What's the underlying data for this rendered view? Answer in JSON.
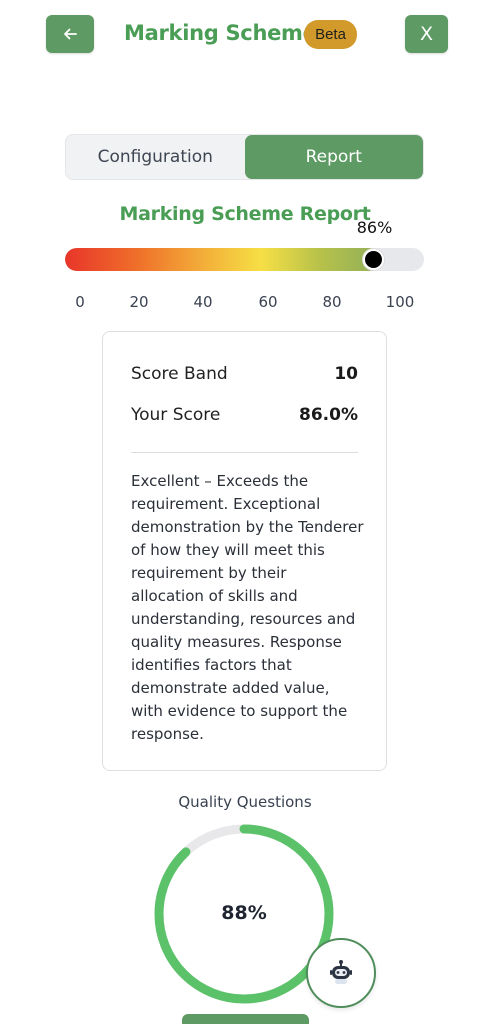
{
  "header": {
    "back_icon": "arrow-left-icon",
    "title": "Marking Scheme",
    "badge": "Beta",
    "close_label": "X"
  },
  "tabs": [
    {
      "label": "Configuration",
      "active": false
    },
    {
      "label": "Report",
      "active": true
    }
  ],
  "report": {
    "title": "Marking Scheme Report",
    "score_percent_label": "86%",
    "score_fraction": 0.86,
    "scale_ticks": [
      "0",
      "20",
      "40",
      "60",
      "80",
      "100"
    ]
  },
  "card": {
    "score_band_label": "Score Band",
    "score_band_value": "10",
    "your_score_label": "Your Score",
    "your_score_value": "86.0%",
    "description": "Excellent – Exceeds the requirement. Exceptional demonstration by the Tenderer of how they will meet this requirement by their allocation of skills and understanding, resources and quality measures. Response identifies factors that demonstrate added value, with evidence to support the response."
  },
  "quality": {
    "label": "Quality Questions",
    "value_label": "88%",
    "fraction": 0.88
  },
  "colors": {
    "primary": "#5e9a63",
    "title_green": "#4a9d55",
    "badge": "#d19a2a",
    "donut_green": "#5cc26a",
    "donut_track": "#e8e8ea"
  },
  "icons": {
    "assistant": "robot-icon"
  }
}
